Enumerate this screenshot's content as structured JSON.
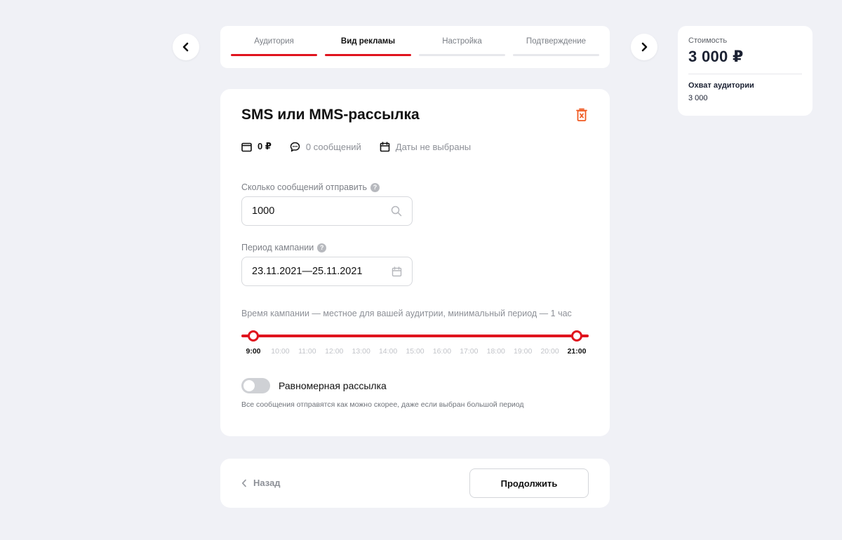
{
  "stepper": {
    "steps": [
      {
        "label": "Аудитория",
        "state": "done"
      },
      {
        "label": "Вид рекламы",
        "state": "active"
      },
      {
        "label": "Настройка",
        "state": "pending"
      },
      {
        "label": "Подтверждение",
        "state": "pending"
      }
    ],
    "accent": "#e0141e"
  },
  "summary": {
    "cost_label": "Стоимость",
    "cost_value": "3 000 ₽",
    "reach_label": "Охват аудитории",
    "reach_value": "3 000"
  },
  "campaign": {
    "title": "SMS или MMS-рассылка",
    "meta": {
      "price": "0 ₽",
      "messages": "0 сообщений",
      "dates": "Даты не выбраны"
    },
    "count_field": {
      "label": "Сколько сообщений отправить",
      "value": "1000"
    },
    "period_field": {
      "label": "Период кампании",
      "value": "23.11.2021—25.11.2021"
    },
    "time": {
      "caption": "Время кампании — местное для вашей аудитрии, минимальный период — 1 час",
      "ticks": [
        "9:00",
        "10:00",
        "11:00",
        "12:00",
        "13:00",
        "14:00",
        "15:00",
        "16:00",
        "17:00",
        "18:00",
        "19:00",
        "20:00",
        "21:00"
      ],
      "range_start": "9:00",
      "range_end": "21:00"
    },
    "even_send": {
      "label": "Равномерная рассылка",
      "enabled": false,
      "hint": "Все сообщения отправятся как можно скорее, даже если выбран большой период"
    }
  },
  "footer": {
    "back_label": "Назад",
    "continue_label": "Продолжить"
  }
}
